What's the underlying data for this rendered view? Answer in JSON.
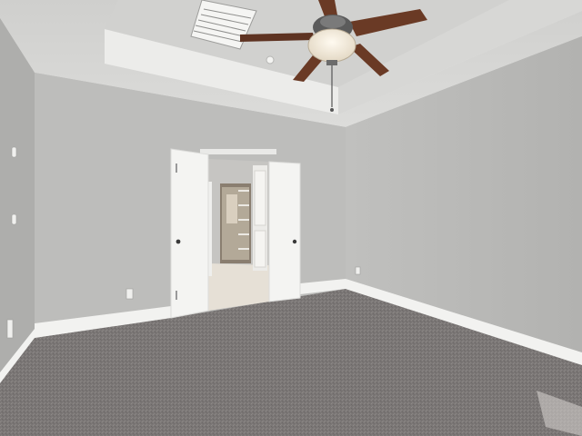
{
  "scene": {
    "description_colors": {
      "wall_left": "#aeaeac",
      "wall_back": "#bdbdbb",
      "wall_right": "#b8b8b6",
      "ceiling": "#d9d9d7",
      "tray_ceiling": "#e4e4e2",
      "carpet": "#7b7776",
      "baseboard": "#f2f2f0",
      "door": "#f4f4f2",
      "closet_floor": "#e6e0d6",
      "fan_blade": "#6a3a25",
      "fan_light": "#efe6d6"
    }
  }
}
